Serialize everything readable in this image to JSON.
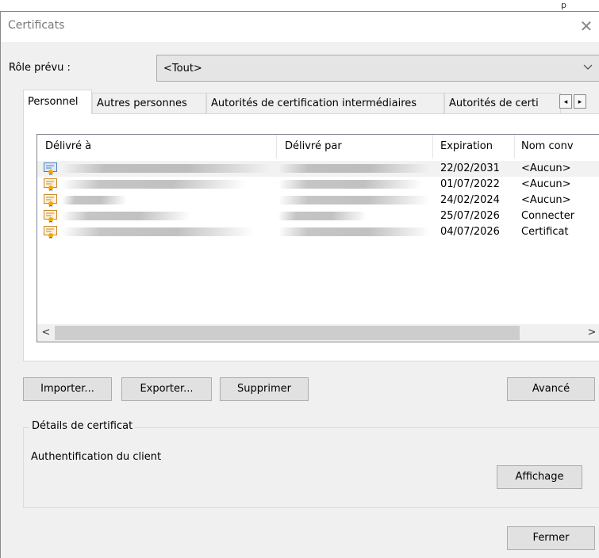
{
  "window": {
    "title": "Certificats",
    "close_glyph": "✕",
    "stub_text": "p"
  },
  "role": {
    "label": "Rôle prévu :",
    "value": "<Tout>"
  },
  "tabs": [
    {
      "label": "Personnel",
      "active": true
    },
    {
      "label": "Autres personnes",
      "active": false
    },
    {
      "label": "Autorités de certification intermédiaires",
      "active": false
    },
    {
      "label": "Autorités de certi",
      "active": false
    }
  ],
  "tab_scroll": {
    "left": "◂",
    "right": "▸"
  },
  "list": {
    "columns": [
      "Délivré à",
      "Délivré par",
      "Expiration",
      "Nom conv"
    ],
    "rows": [
      {
        "expiration": "22/02/2031",
        "name": "<Aucun>",
        "selected": true,
        "icon": "certificate-icon-blue"
      },
      {
        "expiration": "01/07/2022",
        "name": "<Aucun>",
        "selected": false,
        "icon": "certificate-icon-orange"
      },
      {
        "expiration": "24/02/2024",
        "name": "<Aucun>",
        "selected": false,
        "icon": "certificate-icon-orange"
      },
      {
        "expiration": "25/07/2026",
        "name": "Connecter",
        "selected": false,
        "icon": "certificate-icon-orange"
      },
      {
        "expiration": "04/07/2026",
        "name": "Certificat",
        "selected": false,
        "icon": "certificate-icon-orange"
      }
    ]
  },
  "scroll": {
    "left": "<",
    "right": ">"
  },
  "buttons": {
    "import": "Importer...",
    "export": "Exporter...",
    "delete": "Supprimer",
    "advanced": "Avancé",
    "view": "Affichage",
    "close": "Fermer"
  },
  "details": {
    "title": "Détails de certificat",
    "description": "Authentification du client"
  },
  "colors": {
    "selected_row": "#f2f2f2",
    "button_bg": "#e1e1e1",
    "dialog_bg": "#f0f0f0"
  }
}
